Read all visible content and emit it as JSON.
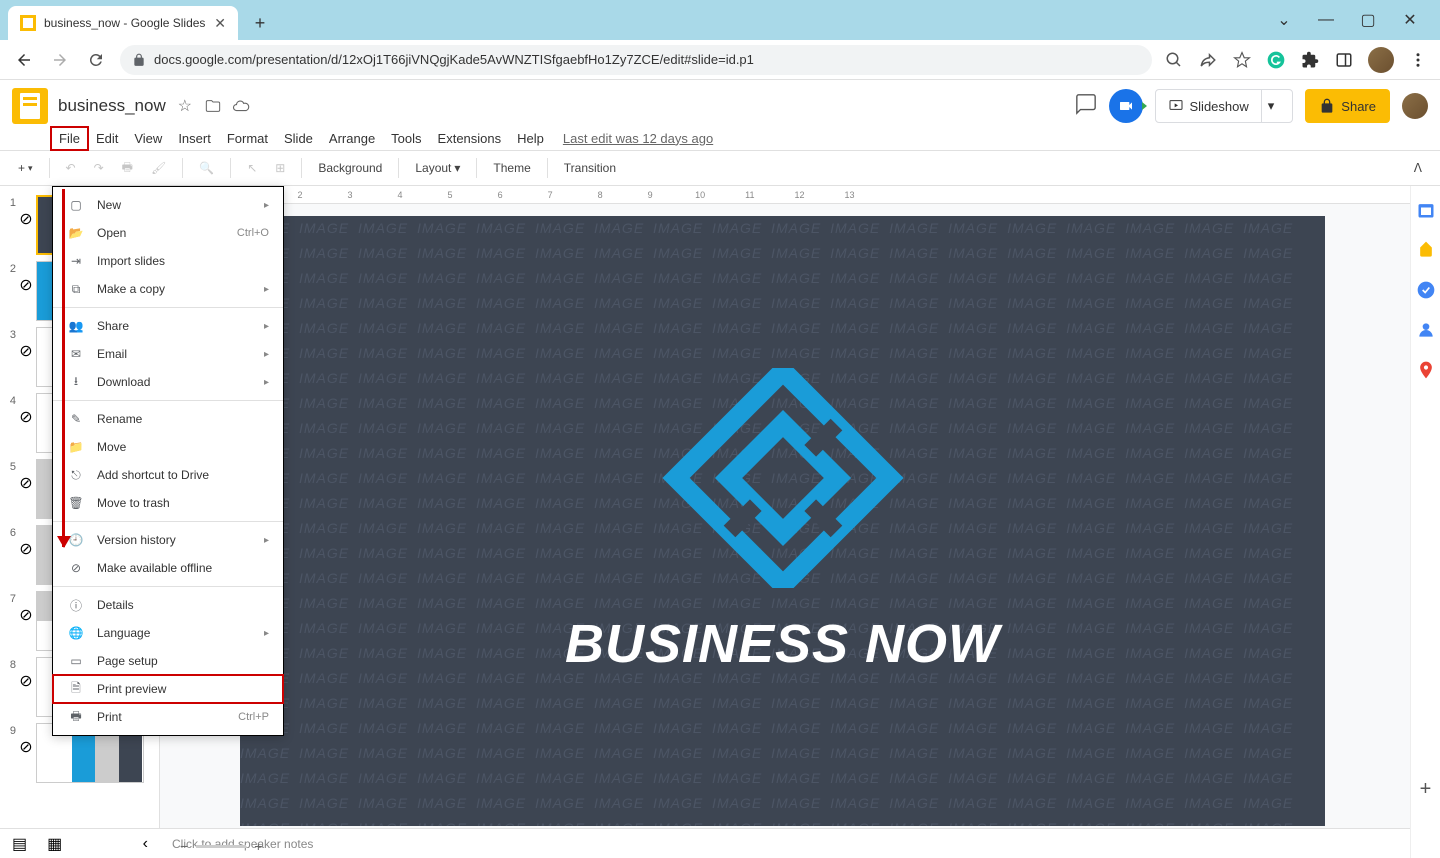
{
  "browser": {
    "tab_title": "business_now - Google Slides",
    "new_tab_label": "+",
    "url": "docs.google.com/presentation/d/12xOj1T66jiVNQgjKade5AvWNZTISfgaebfHo1Zy7ZCE/edit#slide=id.p1",
    "window_controls": {
      "minimize": "—",
      "maximize": "▢",
      "close": "✕",
      "dropdown": "⌄"
    }
  },
  "header": {
    "doc_title": "business_now",
    "slideshow_label": "Slideshow",
    "share_label": "Share",
    "last_edit": "Last edit was 12 days ago"
  },
  "menus": {
    "file": "File",
    "edit": "Edit",
    "view": "View",
    "insert": "Insert",
    "format": "Format",
    "slide": "Slide",
    "arrange": "Arrange",
    "tools": "Tools",
    "extensions": "Extensions",
    "help": "Help"
  },
  "toolbar": {
    "background": "Background",
    "layout": "Layout",
    "theme": "Theme",
    "transition": "Transition"
  },
  "file_menu": {
    "new": "New",
    "open": "Open",
    "open_shortcut": "Ctrl+O",
    "import": "Import slides",
    "copy": "Make a copy",
    "share": "Share",
    "email": "Email",
    "download": "Download",
    "rename": "Rename",
    "move": "Move",
    "shortcut": "Add shortcut to Drive",
    "trash": "Move to trash",
    "version": "Version history",
    "offline": "Make available offline",
    "details": "Details",
    "language": "Language",
    "page_setup": "Page setup",
    "print_preview": "Print preview",
    "print": "Print",
    "print_shortcut": "Ctrl+P"
  },
  "slide": {
    "title": "BUSINESS NOW",
    "bg_word": "IMAGE"
  },
  "notes": {
    "placeholder": "Click to add speaker notes"
  },
  "thumbnails": {
    "count": 9
  }
}
